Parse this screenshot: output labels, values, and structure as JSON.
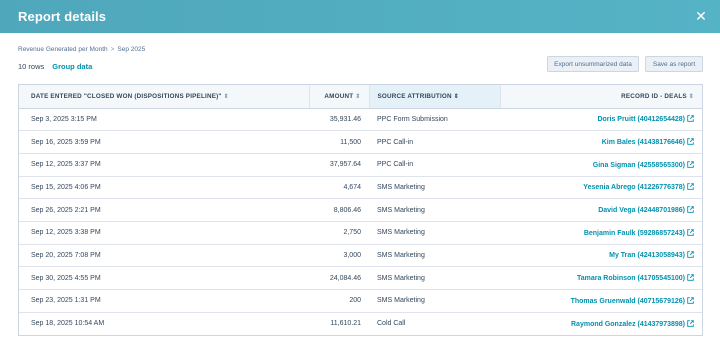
{
  "header": {
    "title": "Report details",
    "close_icon": "close-icon"
  },
  "breadcrumb": {
    "items": [
      "Revenue Generated per Month",
      "Sep 2025"
    ],
    "separator": ">"
  },
  "summary": {
    "rows": "10 rows",
    "group_data": "Group data"
  },
  "buttons": {
    "export": "Export unsummarized data",
    "save": "Save as report"
  },
  "table": {
    "headers": {
      "date": "DATE ENTERED \"CLOSED WON (DISPOSITIONS PIPELINE)\"",
      "amount": "AMOUNT",
      "source": "SOURCE ATTRIBUTION",
      "record": "RECORD ID - DEALS"
    },
    "sorted_column": "source",
    "rows": [
      {
        "date": "Sep 3, 2025 3:15 PM",
        "amount": "35,931.46",
        "source": "PPC Form Submission",
        "record": "Doris Pruitt (40412654428)"
      },
      {
        "date": "Sep 16, 2025 3:59 PM",
        "amount": "11,500",
        "source": "PPC Call-in",
        "record": "Kim Bales (41438176646)"
      },
      {
        "date": "Sep 12, 2025 3:37 PM",
        "amount": "37,957.64",
        "source": "PPC Call-in",
        "record": "Gina Sigman (42558565300)"
      },
      {
        "date": "Sep 15, 2025 4:06 PM",
        "amount": "4,674",
        "source": "SMS Marketing",
        "record": "Yesenia Abrego (41226776378)"
      },
      {
        "date": "Sep 26, 2025 2:21 PM",
        "amount": "8,806.46",
        "source": "SMS Marketing",
        "record": "David Vega (42448701986)"
      },
      {
        "date": "Sep 12, 2025 3:38 PM",
        "amount": "2,750",
        "source": "SMS Marketing",
        "record": "Benjamin Faulk (59286857243)"
      },
      {
        "date": "Sep 20, 2025 7:08 PM",
        "amount": "3,000",
        "source": "SMS Marketing",
        "record": "My Tran (42413058943)"
      },
      {
        "date": "Sep 30, 2025 4:55 PM",
        "amount": "24,084.46",
        "source": "SMS Marketing",
        "record": "Tamara Robinson (41705545100)"
      },
      {
        "date": "Sep 23, 2025 1:31 PM",
        "amount": "200",
        "source": "SMS Marketing",
        "record": "Thomas Gruenwald (40715679126)"
      },
      {
        "date": "Sep 18, 2025 10:54 AM",
        "amount": "11,610.21",
        "source": "Cold Call",
        "record": "Raymond Gonzalez (41437973898)"
      }
    ]
  },
  "colors": {
    "header_bg": "#52adc1",
    "link": "#0091ae",
    "text": "#33475b"
  }
}
